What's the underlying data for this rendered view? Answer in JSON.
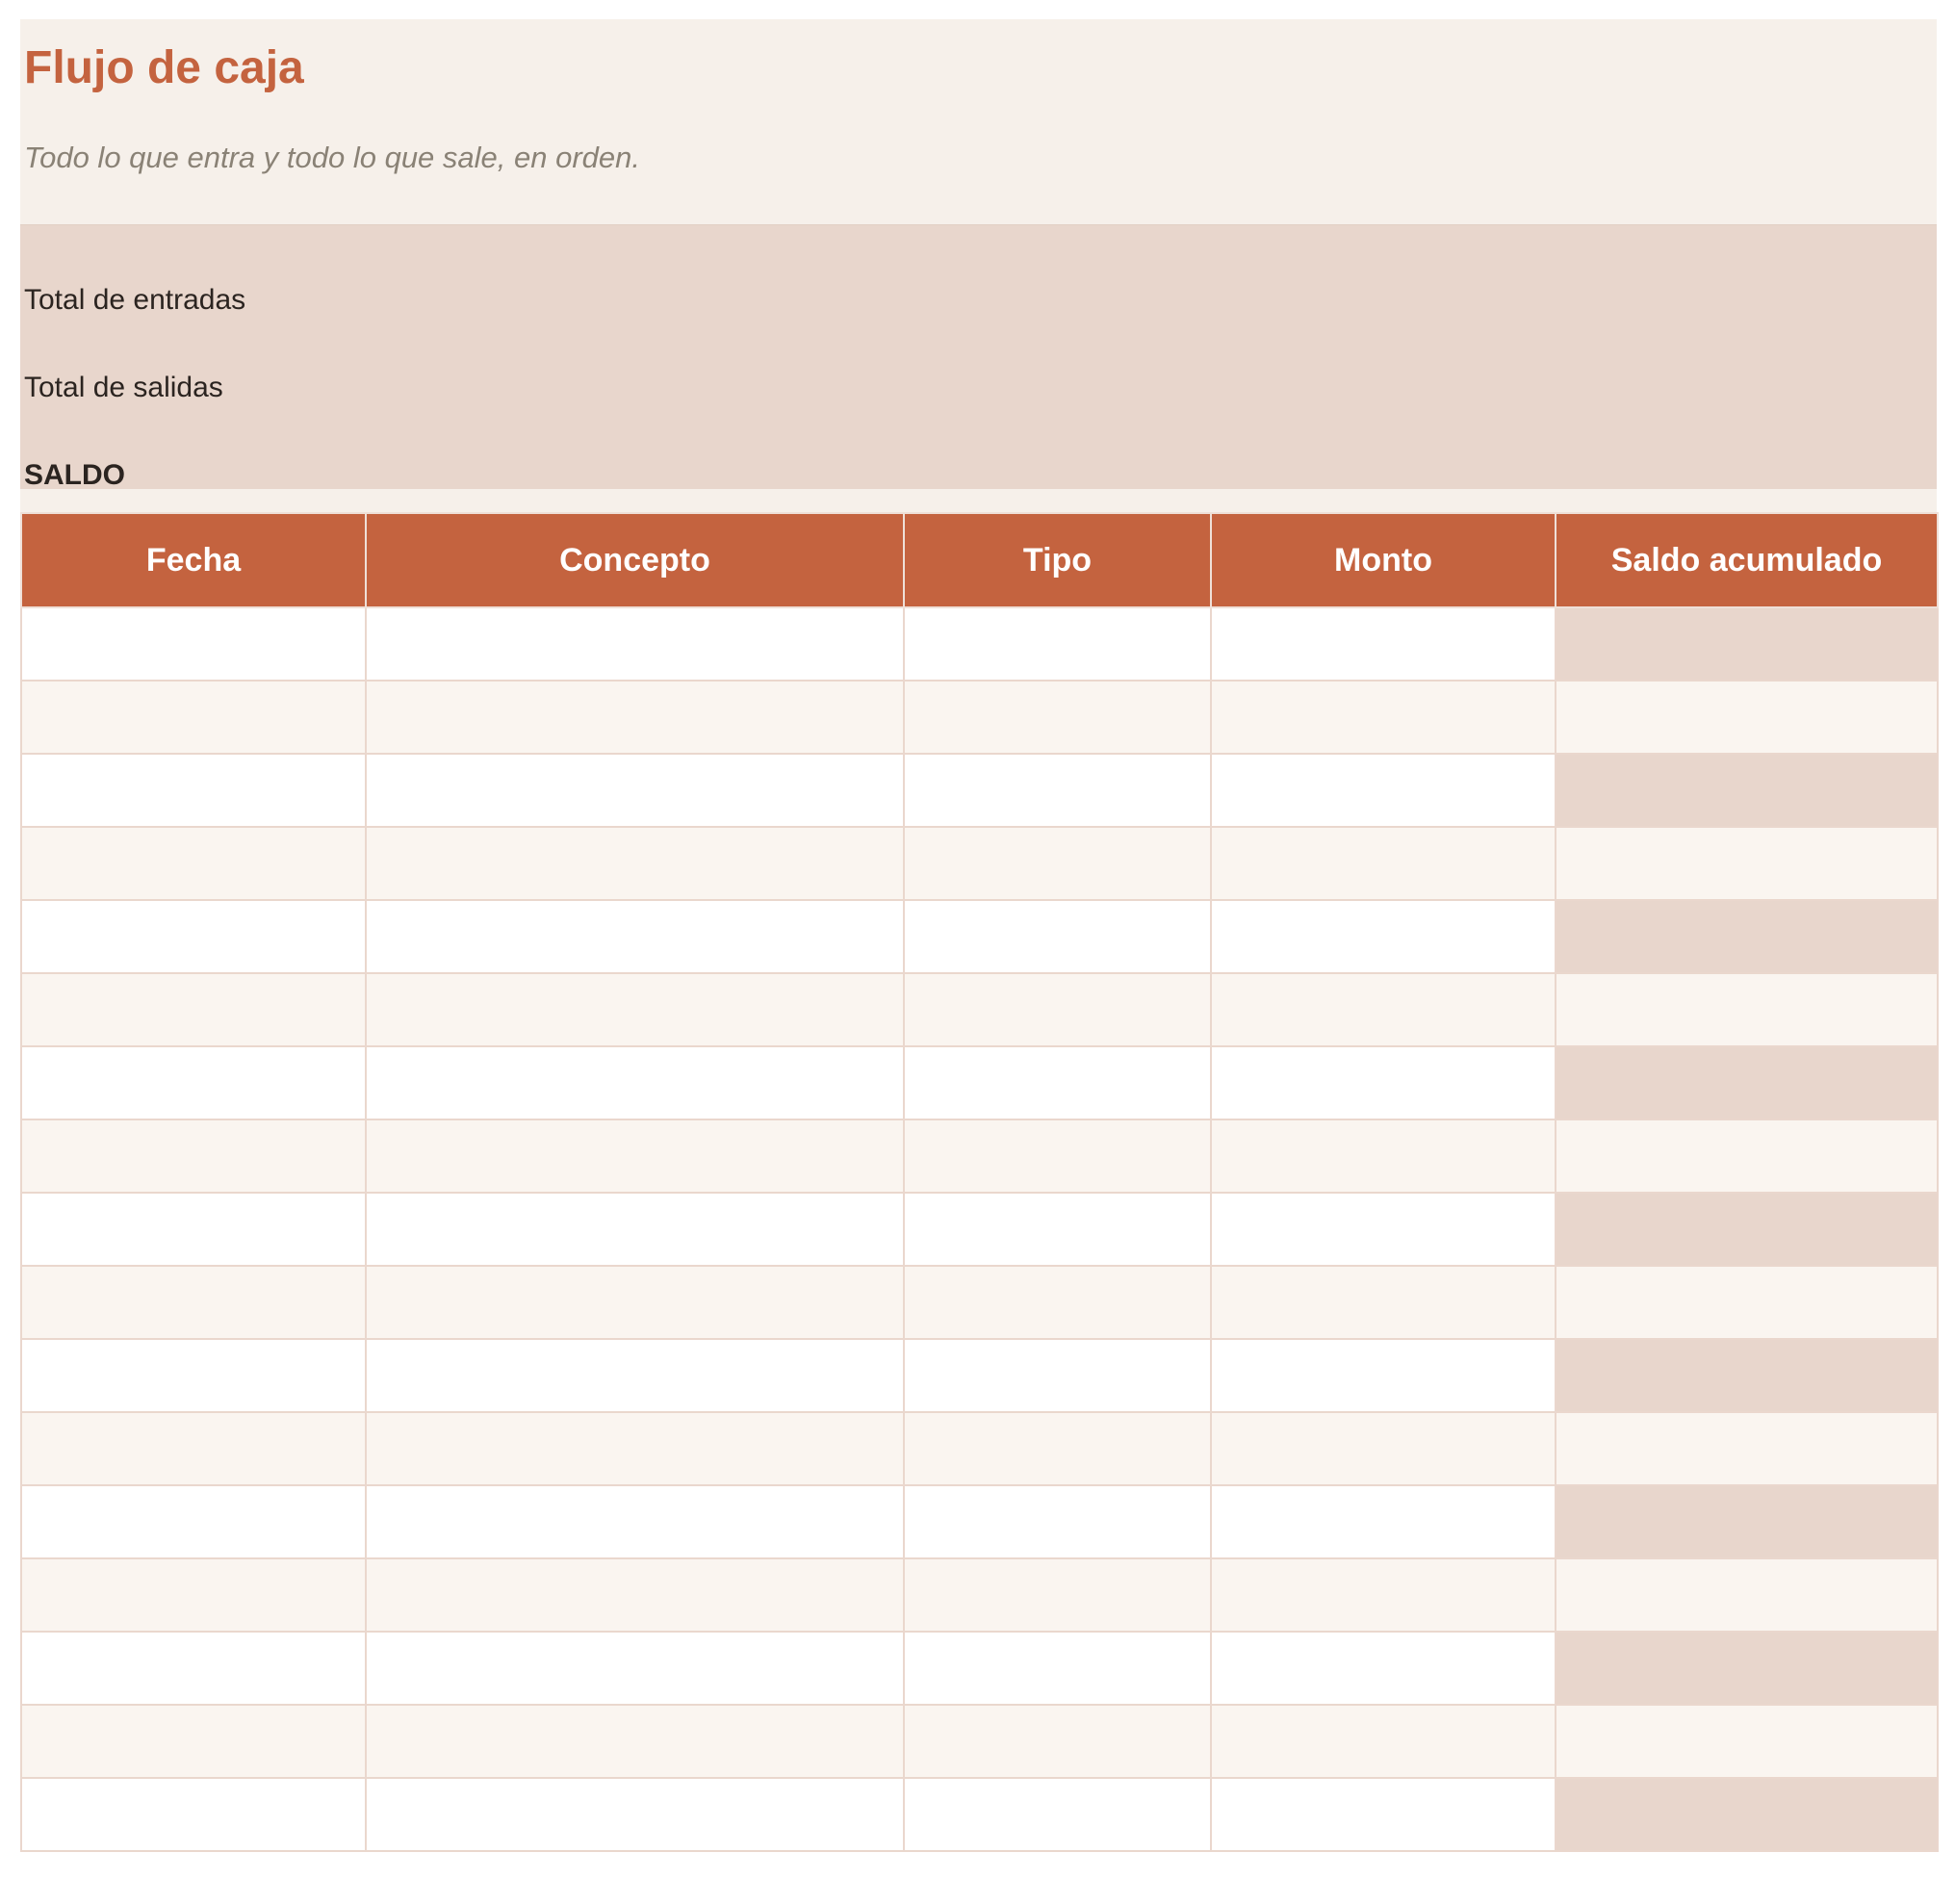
{
  "sheet": {
    "title": "Flujo de caja",
    "subtitle": "Todo lo que entra y todo lo que sale, en orden."
  },
  "summary": {
    "total_in_label": "Total de entradas",
    "total_in_value": "",
    "total_out_label": "Total de salidas",
    "total_out_value": "",
    "balance_label": "SALDO",
    "balance_value": ""
  },
  "table": {
    "columns": [
      "Fecha",
      "Concepto",
      "Tipo",
      "Monto",
      "Saldo acumulado"
    ],
    "rows": [
      [
        "",
        "",
        "",
        "",
        ""
      ],
      [
        "",
        "",
        "",
        "",
        ""
      ],
      [
        "",
        "",
        "",
        "",
        ""
      ],
      [
        "",
        "",
        "",
        "",
        ""
      ],
      [
        "",
        "",
        "",
        "",
        ""
      ],
      [
        "",
        "",
        "",
        "",
        ""
      ],
      [
        "",
        "",
        "",
        "",
        ""
      ],
      [
        "",
        "",
        "",
        "",
        ""
      ],
      [
        "",
        "",
        "",
        "",
        ""
      ],
      [
        "",
        "",
        "",
        "",
        ""
      ],
      [
        "",
        "",
        "",
        "",
        ""
      ],
      [
        "",
        "",
        "",
        "",
        ""
      ],
      [
        "",
        "",
        "",
        "",
        ""
      ],
      [
        "",
        "",
        "",
        "",
        ""
      ],
      [
        "",
        "",
        "",
        "",
        ""
      ],
      [
        "",
        "",
        "",
        "",
        ""
      ],
      [
        "",
        "",
        "",
        "",
        ""
      ]
    ]
  },
  "colors": {
    "accent": "#c4633f",
    "header_bg": "#f6f0ea",
    "summary_bg": "#e8d6cc",
    "row_alt": "#faf5f0"
  }
}
